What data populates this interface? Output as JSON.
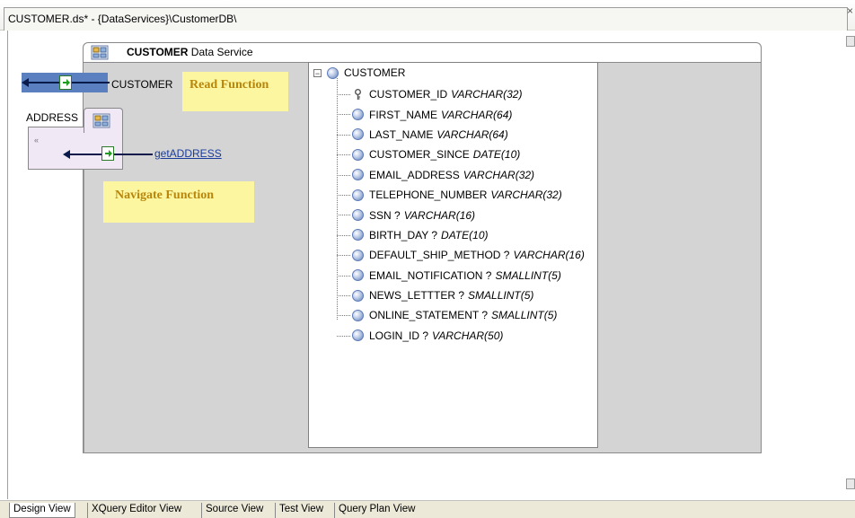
{
  "window": {
    "title": "CUSTOMER.ds* - {DataServices}\\CustomerDB\\",
    "close_glyph": "×"
  },
  "data_service": {
    "name": "CUSTOMER",
    "suffix": "Data Service"
  },
  "canvas": {
    "read_function": {
      "label": "CUSTOMER",
      "note": "Read Function"
    },
    "navigate_function": {
      "entity": "ADDRESS",
      "link": "getADDRESS",
      "note": "Navigate Function",
      "collapse_glyph": "«"
    }
  },
  "tree": {
    "root": "CUSTOMER",
    "expander": "−",
    "fields": [
      {
        "name": "CUSTOMER_ID",
        "type": "VARCHAR(32)",
        "icon": "key-icon"
      },
      {
        "name": "FIRST_NAME",
        "type": "VARCHAR(64)",
        "icon": "element-icon"
      },
      {
        "name": "LAST_NAME",
        "type": "VARCHAR(64)",
        "icon": "element-icon"
      },
      {
        "name": "CUSTOMER_SINCE",
        "type": "DATE(10)",
        "icon": "element-icon"
      },
      {
        "name": "EMAIL_ADDRESS",
        "type": "VARCHAR(32)",
        "icon": "element-icon"
      },
      {
        "name": "TELEPHONE_NUMBER",
        "type": "VARCHAR(32)",
        "icon": "element-icon"
      },
      {
        "name": "SSN ?",
        "type": "VARCHAR(16)",
        "icon": "element-icon"
      },
      {
        "name": "BIRTH_DAY ?",
        "type": "DATE(10)",
        "icon": "element-icon"
      },
      {
        "name": "DEFAULT_SHIP_METHOD ?",
        "type": "VARCHAR(16)",
        "icon": "element-icon"
      },
      {
        "name": "EMAIL_NOTIFICATION ?",
        "type": "SMALLINT(5)",
        "icon": "element-icon"
      },
      {
        "name": "NEWS_LETTTER ?",
        "type": "SMALLINT(5)",
        "icon": "element-icon"
      },
      {
        "name": "ONLINE_STATEMENT ?",
        "type": "SMALLINT(5)",
        "icon": "element-icon"
      },
      {
        "name": "LOGIN_ID ?",
        "type": "VARCHAR(50)",
        "icon": "element-icon"
      }
    ]
  },
  "bottom_tabs": [
    "Design View",
    "XQuery Editor View",
    "Source View",
    "Test View",
    "Query Plan View"
  ],
  "active_tab": "Design View"
}
